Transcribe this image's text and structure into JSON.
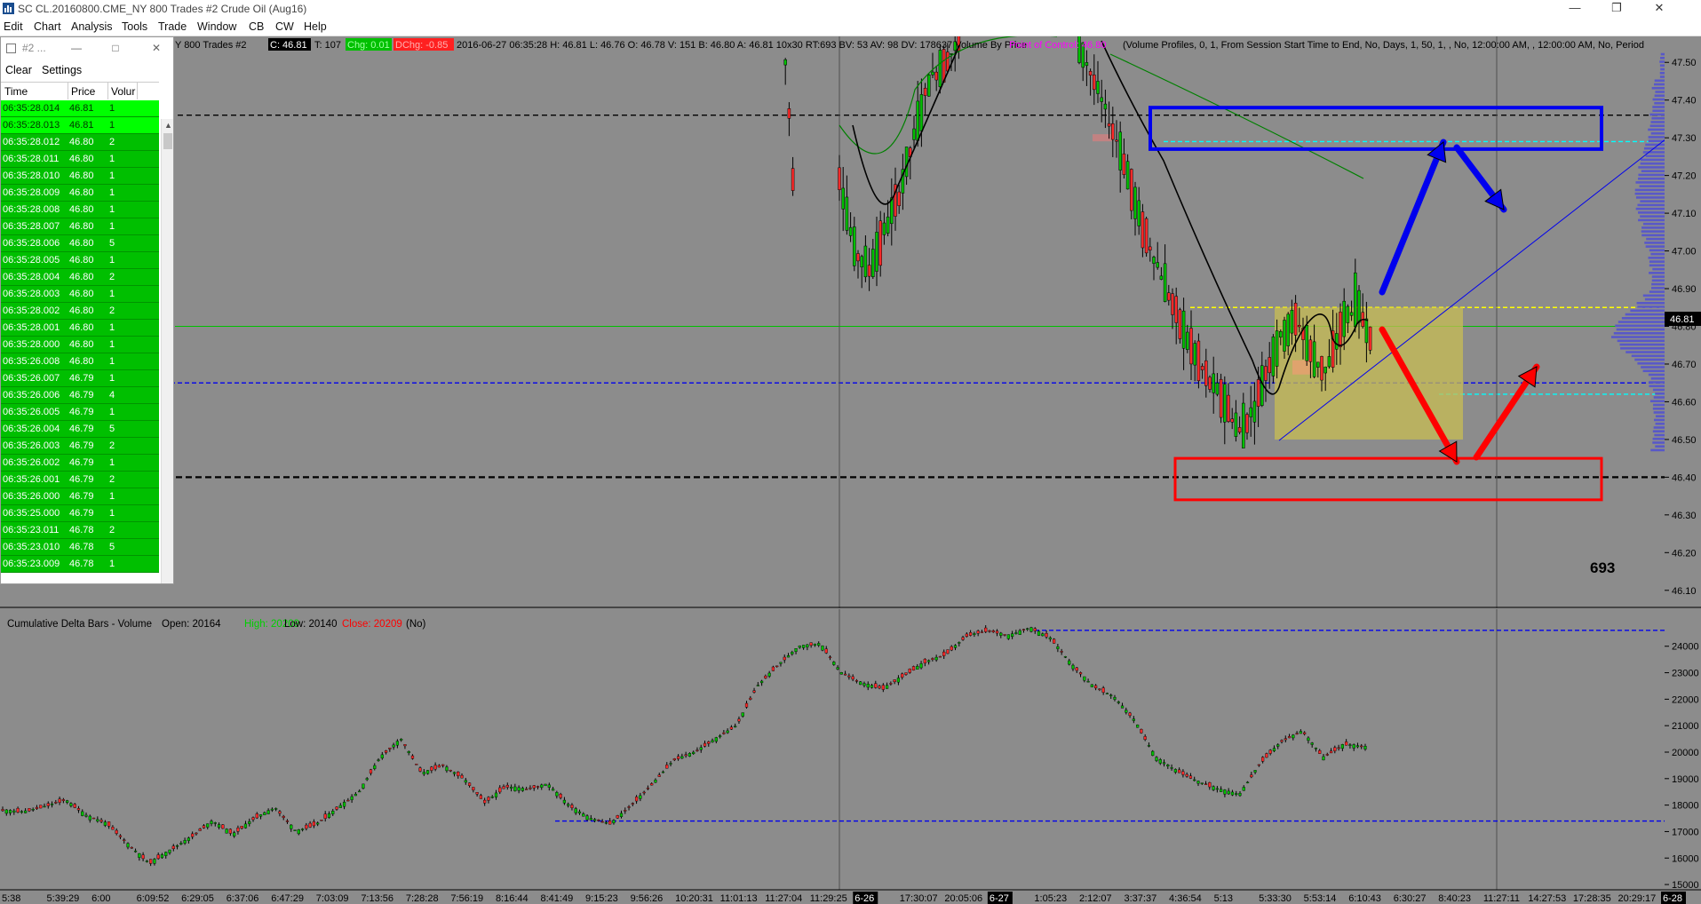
{
  "window": {
    "title": "SC CL.20160800.CME_NY  800 Trades  #2  Crude Oil (Aug16)"
  },
  "menu": [
    "Edit",
    "Chart",
    "Analysis",
    "Tools",
    "Trade",
    "Window",
    "CB",
    "CW",
    "Help"
  ],
  "chart_header": {
    "prefix": "Y  800 Trades  #2",
    "c_label": "C: 46.81",
    "t": "T: 107",
    "chg": "Chg: 0.01",
    "dchg": "DChg: -0.85",
    "info": "2016-06-27 06:35:28  H: 46.81  L: 46.76  O: 46.78  V: 151  B: 46.80  A: 46.81  10x30  RT:693  BV: 53  AV: 98  DV: 178637  Volume By Price",
    "poc": "Point of Control: 46.80",
    "params": "(Volume Profiles, 0, 1, From Session Start Time to End, No, Days, 1, 50, 1, , No, 12:00:00 AM, , 12:00:00 AM, No, Period"
  },
  "delta_header": {
    "name": "Cumulative Delta Bars - Volume",
    "open": "Open: 20164",
    "high": "High: 20209",
    "low": "Low: 20140",
    "close": "Close: 20209",
    "tail": "(No)"
  },
  "counter": "693",
  "time_and_sales": {
    "title": "#2 ...",
    "menu": [
      "Clear",
      "Settings"
    ],
    "columns": [
      "Time",
      "Price",
      "Volur"
    ],
    "rows": [
      [
        "06:35:28.014",
        "46.81",
        "1"
      ],
      [
        "06:35:28.013",
        "46.81",
        "1"
      ],
      [
        "06:35:28.012",
        "46.80",
        "2"
      ],
      [
        "06:35:28.011",
        "46.80",
        "1"
      ],
      [
        "06:35:28.010",
        "46.80",
        "1"
      ],
      [
        "06:35:28.009",
        "46.80",
        "1"
      ],
      [
        "06:35:28.008",
        "46.80",
        "1"
      ],
      [
        "06:35:28.007",
        "46.80",
        "1"
      ],
      [
        "06:35:28.006",
        "46.80",
        "5"
      ],
      [
        "06:35:28.005",
        "46.80",
        "1"
      ],
      [
        "06:35:28.004",
        "46.80",
        "2"
      ],
      [
        "06:35:28.003",
        "46.80",
        "1"
      ],
      [
        "06:35:28.002",
        "46.80",
        "2"
      ],
      [
        "06:35:28.001",
        "46.80",
        "1"
      ],
      [
        "06:35:28.000",
        "46.80",
        "1"
      ],
      [
        "06:35:26.008",
        "46.80",
        "1"
      ],
      [
        "06:35:26.007",
        "46.79",
        "1"
      ],
      [
        "06:35:26.006",
        "46.79",
        "4"
      ],
      [
        "06:35:26.005",
        "46.79",
        "1"
      ],
      [
        "06:35:26.004",
        "46.79",
        "5"
      ],
      [
        "06:35:26.003",
        "46.79",
        "2"
      ],
      [
        "06:35:26.002",
        "46.79",
        "1"
      ],
      [
        "06:35:26.001",
        "46.79",
        "2"
      ],
      [
        "06:35:26.000",
        "46.79",
        "1"
      ],
      [
        "06:35:25.000",
        "46.79",
        "1"
      ],
      [
        "06:35:23.011",
        "46.78",
        "2"
      ],
      [
        "06:35:23.010",
        "46.78",
        "5"
      ],
      [
        "06:35:23.009",
        "46.78",
        "1"
      ]
    ]
  },
  "chart_data": [
    {
      "type": "candlestick",
      "ylim": [
        46.05,
        47.55
      ],
      "price_ticks": [
        "47.50",
        "47.40",
        "47.30",
        "47.20",
        "47.10",
        "47.00",
        "46.90",
        "46.80",
        "46.70",
        "46.60",
        "46.50",
        "46.40",
        "46.30",
        "46.20",
        "46.10"
      ],
      "last_price_label": "46.81",
      "time_labels": [
        "5:38",
        "5:39:29",
        "6:00",
        "6:09:52",
        "6:29:05",
        "6:37:06",
        "6:47:29",
        "7:03:09",
        "7:13:56",
        "7:28:28",
        "7:56:19",
        "8:16:44",
        "8:41:49",
        "9:15:23",
        "9:56:26",
        "10:20:31",
        "11:01:13",
        "11:27:04",
        "11:29:25",
        "6-26",
        "17:30:07",
        "20:05:06",
        "6-27",
        "1:05:23",
        "2:12:07",
        "3:37:37",
        "4:36:54",
        "5:13",
        "5:33:30",
        "5:53:14",
        "6:10:43",
        "6:30:27",
        "8:40:23",
        "11:27:11",
        "14:27:53",
        "17:28:35",
        "20:29:17",
        "6-28"
      ],
      "price_path": [
        47.6,
        47.45,
        47.2,
        47.0,
        46.95,
        47.05,
        47.15,
        47.3,
        47.45,
        47.5,
        47.55,
        47.45,
        47.35,
        47.25,
        47.1,
        47.0,
        46.9,
        46.8,
        46.72,
        46.65,
        46.6,
        46.52,
        46.58,
        46.7,
        46.78,
        46.82,
        46.72,
        46.68,
        46.8,
        46.86,
        46.78
      ],
      "horizontal_levels": [
        {
          "price": 47.36,
          "style": "black-dashed"
        },
        {
          "price": 46.4,
          "style": "black-dashed-bold"
        },
        {
          "price": 46.65,
          "style": "blue-dashed"
        },
        {
          "price": 46.85,
          "style": "yellow-dashed"
        },
        {
          "price": 46.62,
          "style": "cyan-dashed"
        },
        {
          "price": 47.29,
          "style": "cyan-dashed"
        },
        {
          "price": 46.8,
          "style": "green-poc"
        }
      ],
      "annotations": {
        "blue_box": [
          47.38,
          47.27
        ],
        "red_box": [
          46.45,
          46.34
        ],
        "yellow_box": [
          46.85,
          46.5
        ]
      }
    },
    {
      "type": "candlestick",
      "name": "Cumulative Delta Bars - Volume",
      "ylim": [
        14600,
        25400
      ],
      "y_ticks": [
        "24000",
        "23000",
        "22000",
        "21000",
        "20000",
        "19000",
        "18000",
        "17000",
        "16000",
        "15000"
      ],
      "values": [
        17800,
        17750,
        17950,
        18200,
        17600,
        17300,
        16500,
        15800,
        16300,
        16800,
        17400,
        16900,
        17500,
        17900,
        17000,
        17300,
        17900,
        18500,
        19800,
        20500,
        19200,
        19500,
        19000,
        18100,
        18700,
        18600,
        18800,
        18000,
        17500,
        17300,
        18000,
        18800,
        19700,
        20000,
        20500,
        21000,
        22500,
        23300,
        24000,
        24100,
        23000,
        22600,
        22400,
        22900,
        23400,
        23700,
        24400,
        24600,
        24400,
        24700,
        24300,
        23300,
        22500,
        22100,
        21200,
        19800,
        19300,
        18900,
        18600,
        18400,
        19600,
        20400,
        20800,
        19800,
        20300,
        20200
      ],
      "levels": [
        24600,
        17400
      ]
    }
  ],
  "colors": {
    "background": "#8c8c8c",
    "up_candle": "#00c000",
    "down_candle": "#ff2a2a",
    "blue_annotation": "#0000ee",
    "red_annotation": "#ff0000"
  }
}
